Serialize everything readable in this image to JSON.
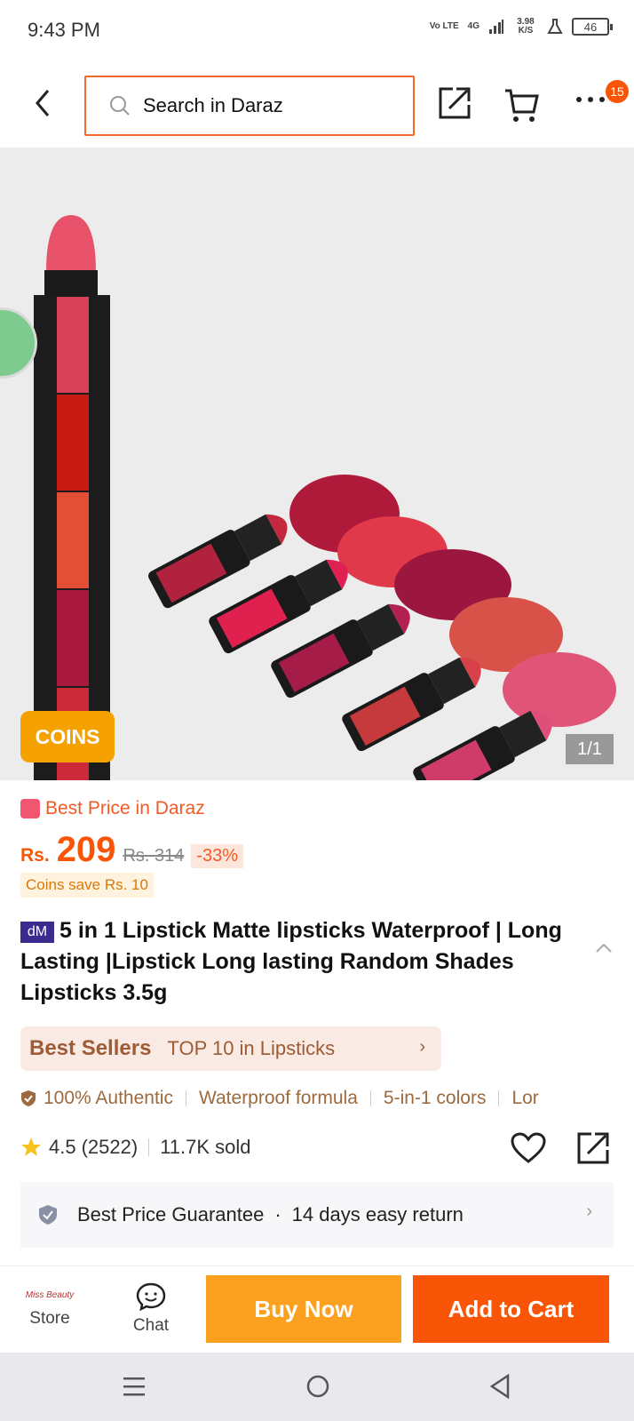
{
  "status_bar": {
    "time": "9:43 PM",
    "net_volte": "Vo LTE",
    "net_4g": "4G",
    "speed": "3.98 K/S",
    "battery": "46"
  },
  "header": {
    "search_placeholder": "Search in Daraz",
    "cart_badge": "15"
  },
  "gallery": {
    "coins_tag": "COINS",
    "counter": "1/1"
  },
  "product": {
    "best_price": "Best Price in Daraz",
    "currency": "Rs.",
    "price": "209",
    "original_price": "Rs. 314",
    "discount": "-33%",
    "coins_save": "Coins save Rs. 10",
    "brand_logo": "dM",
    "title": "5 in 1 Lipstick Matte lipsticks Waterproof | Long Lasting |Lipstick Long lasting Random Shades Lipsticks 3.5g",
    "best_sellers_label": "Best Sellers",
    "best_sellers_rank": "TOP 10 in Lipsticks",
    "tags": [
      "100% Authentic",
      "Waterproof formula",
      "5-in-1 colors",
      "Lor"
    ],
    "rating": "4.5",
    "rating_count": "(2522)",
    "sold": "11.7K sold"
  },
  "guarantee": {
    "line1": "Best Price Guarantee",
    "dot": "·",
    "line2": "14 days easy return"
  },
  "action_bar": {
    "store_label": "Store",
    "store_logo_text": "Miss Beauty",
    "chat_label": "Chat",
    "buy_now": "Buy Now",
    "add_to_cart": "Add to Cart"
  },
  "colors": {
    "brand_orange": "#f85606",
    "buy_now_yellow": "#fca11f",
    "best_seller_bg": "#f9ebe4"
  }
}
